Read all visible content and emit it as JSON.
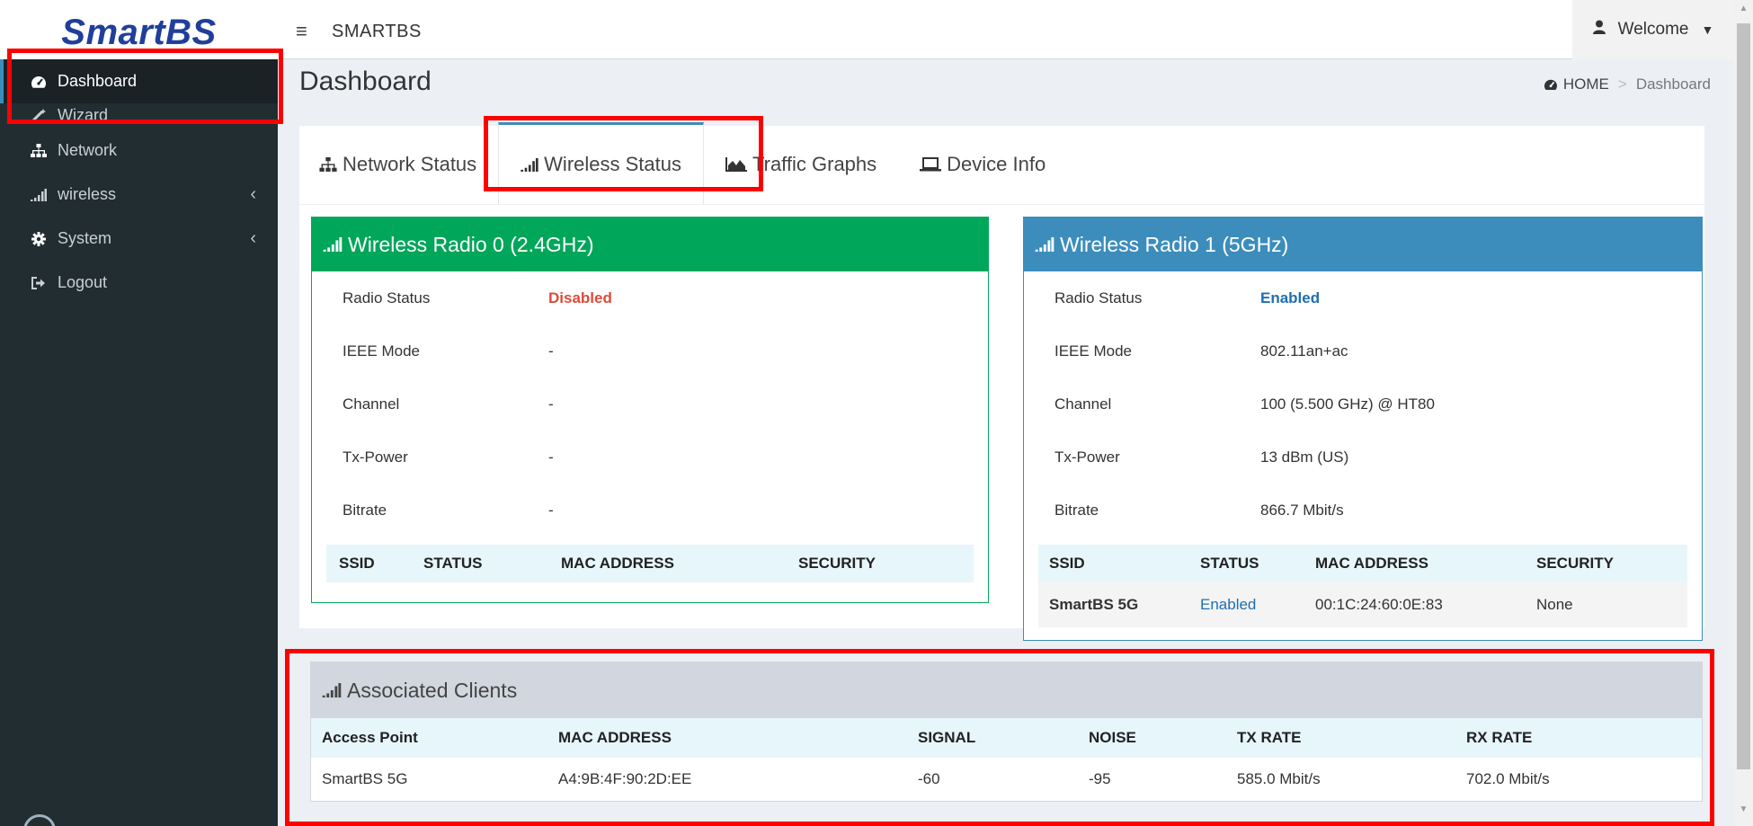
{
  "app": {
    "logo": "SmartBS",
    "title": "SMARTBS",
    "user_menu": "Welcome"
  },
  "sidebar": {
    "items": [
      {
        "label": "Dashboard",
        "icon": "dashboard-icon"
      },
      {
        "label": "Wizard",
        "icon": "wand-icon"
      },
      {
        "label": "Network",
        "icon": "sitemap-icon"
      },
      {
        "label": "wireless",
        "icon": "signal-icon"
      },
      {
        "label": "System",
        "icon": "gear-icon"
      },
      {
        "label": "Logout",
        "icon": "sign-out-icon"
      }
    ]
  },
  "page": {
    "title": "Dashboard",
    "breadcrumb": {
      "home": "HOME",
      "separator": ">",
      "current": "Dashboard"
    }
  },
  "tabs": [
    {
      "label": "Network Status",
      "icon": "sitemap-icon"
    },
    {
      "label": "Wireless Status",
      "icon": "signal-icon",
      "active": true
    },
    {
      "label": "Traffic Graphs",
      "icon": "area-chart-icon"
    },
    {
      "label": "Device Info",
      "icon": "laptop-icon"
    }
  ],
  "radio0": {
    "title": "Wireless Radio 0 (2.4GHz)",
    "header_color": "#00a65a",
    "rows": [
      {
        "key": "Radio Status",
        "value": "Disabled"
      },
      {
        "key": "IEEE Mode",
        "value": "-"
      },
      {
        "key": "Channel",
        "value": "-"
      },
      {
        "key": "Tx-Power",
        "value": "-"
      },
      {
        "key": "Bitrate",
        "value": "-"
      }
    ],
    "table_headers": [
      "SSID",
      "STATUS",
      "MAC ADDRESS",
      "SECURITY"
    ]
  },
  "radio1": {
    "title": "Wireless Radio 1 (5GHz)",
    "header_color": "#3c8dbc",
    "rows": [
      {
        "key": "Radio Status",
        "value": "Enabled"
      },
      {
        "key": "IEEE Mode",
        "value": "802.11an+ac"
      },
      {
        "key": "Channel",
        "value": "100 (5.500 GHz) @ HT80"
      },
      {
        "key": "Tx-Power",
        "value": "13 dBm (US)"
      },
      {
        "key": "Bitrate",
        "value": "866.7 Mbit/s"
      }
    ],
    "table_headers": [
      "SSID",
      "STATUS",
      "MAC ADDRESS",
      "SECURITY"
    ],
    "table_rows": [
      {
        "ssid": "SmartBS 5G",
        "status": "Enabled",
        "mac": "00:1C:24:60:0E:83",
        "security": "None"
      }
    ]
  },
  "clients": {
    "title": "Associated Clients",
    "headers": [
      "Access Point",
      "MAC ADDRESS",
      "SIGNAL",
      "NOISE",
      "TX RATE",
      "RX RATE"
    ],
    "rows": [
      {
        "ap": "SmartBS 5G",
        "mac": "A4:9B:4F:90:2D:EE",
        "signal": "-60",
        "noise": "-95",
        "tx": "585.0 Mbit/s",
        "rx": "702.0 Mbit/s"
      }
    ]
  },
  "colors": {
    "sidebar_bg": "#222d32",
    "accent": "#3c8dbc",
    "green": "#00a65a",
    "danger": "#dd4b39",
    "highlight": "#ff0000"
  }
}
